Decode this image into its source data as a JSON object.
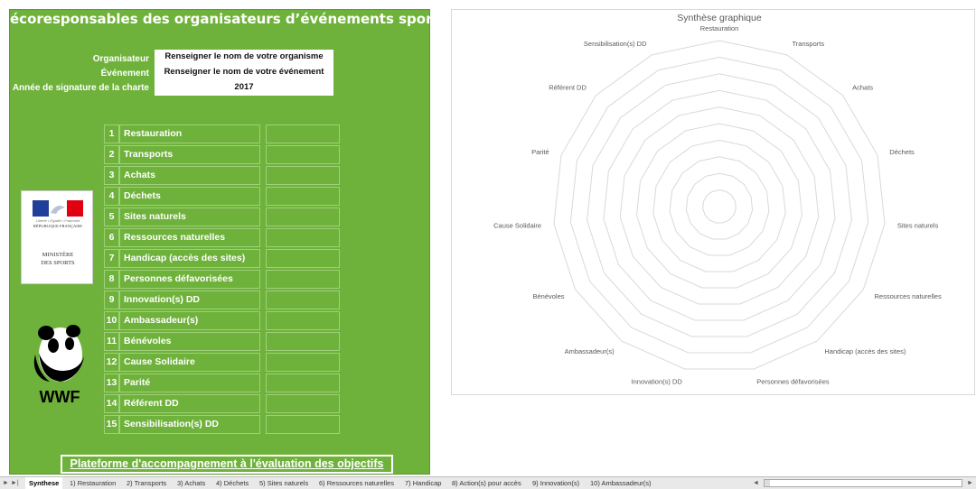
{
  "title": "écoresponsables des organisateurs d’événements sportifs »",
  "info": {
    "organisateur_label": "Organisateur",
    "organisateur_value": "Renseigner le nom de votre organisme",
    "evenement_label": "Événement",
    "evenement_value": "Renseigner le nom de votre événement",
    "annee_label": "Année de signature de la charte",
    "annee_value": "2017"
  },
  "objectives": [
    {
      "num": "1",
      "name": "Restauration",
      "score": ""
    },
    {
      "num": "2",
      "name": "Transports",
      "score": ""
    },
    {
      "num": "3",
      "name": "Achats",
      "score": ""
    },
    {
      "num": "4",
      "name": "Déchets",
      "score": ""
    },
    {
      "num": "5",
      "name": "Sites naturels",
      "score": ""
    },
    {
      "num": "6",
      "name": "Ressources naturelles",
      "score": ""
    },
    {
      "num": "7",
      "name": "Handicap (accès des sites)",
      "score": ""
    },
    {
      "num": "8",
      "name": "Personnes défavorisées",
      "score": ""
    },
    {
      "num": "9",
      "name": "Innovation(s) DD",
      "score": ""
    },
    {
      "num": "10",
      "name": "Ambassadeur(s)",
      "score": ""
    },
    {
      "num": "11",
      "name": "Bénévoles",
      "score": ""
    },
    {
      "num": "12",
      "name": "Cause Solidaire",
      "score": ""
    },
    {
      "num": "13",
      "name": "Parité",
      "score": ""
    },
    {
      "num": "14",
      "name": "Référent DD",
      "score": ""
    },
    {
      "num": "15",
      "name": "Sensibilisation(s) DD",
      "score": ""
    }
  ],
  "logos": {
    "rf_motto": "Liberté • Égalité • Fraternité",
    "rf_text": "RÉPUBLIQUE FRANÇAISE",
    "ministere_text": "MINISTÈRE\nDES SPORTS",
    "wwf_text": "WWF"
  },
  "platform_button": "Plateforme d'accompagnement à l'évaluation des objectifs",
  "chart_data": {
    "type": "radar",
    "title": "Synthèse graphique",
    "axes": [
      "Restauration",
      "Transports",
      "Achats",
      "Déchets",
      "Sites naturels",
      "Ressources naturelles",
      "Handicap (accès des sites)",
      "Personnes défavorisées",
      "Innovation(s) DD",
      "Ambassadeur(s)",
      "Bénévoles",
      "Cause Solidaire",
      "Parité",
      "Référent DD",
      "Sensibilisation(s) DD"
    ],
    "rings": 10,
    "series": []
  },
  "tabs": [
    "Synthese",
    "1) Restauration",
    "2) Transports",
    "3) Achats",
    "4) Déchets",
    "5) Sites naturels",
    "6) Ressources naturelles",
    "7) Handicap",
    "8) Action(s) pour accès",
    "9) Innovation(s)",
    "10) Ambassadeur(s)"
  ],
  "colors": {
    "green": "#6fb23b",
    "grid": "#d9d9d9",
    "flag_blue": "#1f3f9a",
    "flag_red": "#e1000f"
  }
}
